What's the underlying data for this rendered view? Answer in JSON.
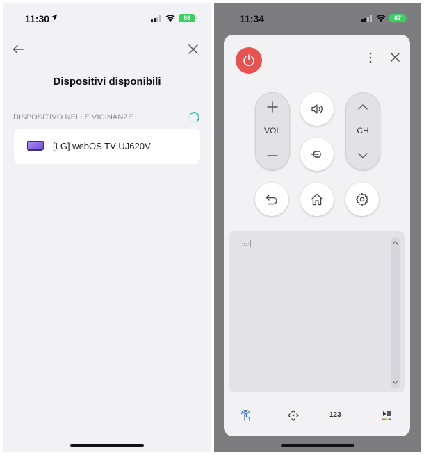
{
  "left_screen": {
    "status_bar": {
      "time": "11:30",
      "battery": "86"
    },
    "header": {
      "title": "Dispositivi disponibili"
    },
    "section": {
      "label": "DISPOSITIVO NELLE VICINANZE"
    },
    "devices": [
      {
        "name": "[LG] webOS TV UJ620V"
      }
    ]
  },
  "right_screen": {
    "status_bar": {
      "time": "11:34",
      "battery": "87"
    },
    "remote": {
      "volume_label": "VOL",
      "channel_label": "CH",
      "numpad_label": "123",
      "colors": {
        "power": "#e8524f",
        "panel": "#f2f2f4",
        "touchpad": "#e4e4e8"
      }
    }
  }
}
